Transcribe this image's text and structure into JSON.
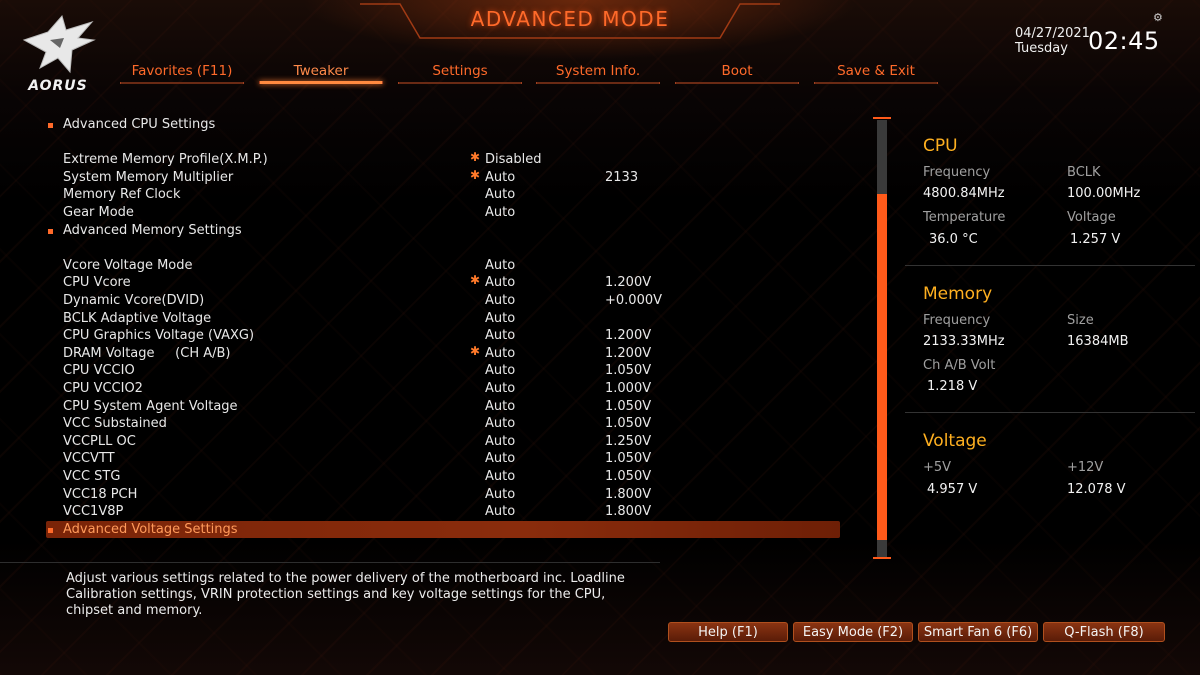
{
  "brand": "AORUS",
  "header": {
    "title": "ADVANCED MODE",
    "date": "04/27/2021",
    "day": "Tuesday",
    "time": "02:45"
  },
  "tabs": [
    {
      "label": "Favorites (F11)",
      "active": false
    },
    {
      "label": "Tweaker",
      "active": true
    },
    {
      "label": "Settings",
      "active": false
    },
    {
      "label": "System Info.",
      "active": false
    },
    {
      "label": "Boot",
      "active": false
    },
    {
      "label": "Save & Exit",
      "active": false
    }
  ],
  "settings": [
    {
      "label": "Advanced CPU Settings",
      "submenu": true,
      "value": "",
      "current": "",
      "star": false
    },
    {
      "label": "",
      "spacer": true
    },
    {
      "label": "Extreme Memory Profile(X.M.P.)",
      "value": "Disabled",
      "current": "",
      "star": true
    },
    {
      "label": "System Memory Multiplier",
      "value": "Auto",
      "current": "2133",
      "star": true
    },
    {
      "label": "Memory Ref Clock",
      "value": "Auto",
      "current": "",
      "star": false
    },
    {
      "label": "Gear Mode",
      "value": "Auto",
      "current": "",
      "star": false
    },
    {
      "label": "Advanced Memory Settings",
      "submenu": true,
      "value": "",
      "current": "",
      "star": false
    },
    {
      "label": "",
      "spacer": true
    },
    {
      "label": "Vcore Voltage Mode",
      "value": "Auto",
      "current": "",
      "star": false
    },
    {
      "label": "CPU Vcore",
      "value": "Auto",
      "current": "1.200V",
      "star": true
    },
    {
      "label": "Dynamic Vcore(DVID)",
      "value": "Auto",
      "current": "+0.000V",
      "star": false
    },
    {
      "label": "BCLK Adaptive Voltage",
      "value": "Auto",
      "current": "",
      "star": false
    },
    {
      "label": "CPU Graphics Voltage (VAXG)",
      "value": "Auto",
      "current": "1.200V",
      "star": false
    },
    {
      "label": "DRAM Voltage     (CH A/B)",
      "value": "Auto",
      "current": "1.200V",
      "star": true
    },
    {
      "label": "CPU VCCIO",
      "value": "Auto",
      "current": "1.050V",
      "star": false
    },
    {
      "label": "CPU VCCIO2",
      "value": "Auto",
      "current": "1.000V",
      "star": false
    },
    {
      "label": "CPU System Agent Voltage",
      "value": "Auto",
      "current": "1.050V",
      "star": false
    },
    {
      "label": "VCC Substained",
      "value": "Auto",
      "current": "1.050V",
      "star": false
    },
    {
      "label": "VCCPLL OC",
      "value": "Auto",
      "current": "1.250V",
      "star": false
    },
    {
      "label": "VCCVTT",
      "value": "Auto",
      "current": "1.050V",
      "star": false
    },
    {
      "label": "VCC STG",
      "value": "Auto",
      "current": "1.050V",
      "star": false
    },
    {
      "label": "VCC18 PCH",
      "value": "Auto",
      "current": "1.800V",
      "star": false
    },
    {
      "label": "VCC1V8P",
      "value": "Auto",
      "current": "1.800V",
      "star": false
    },
    {
      "label": "Advanced Voltage Settings",
      "submenu": true,
      "selected": true,
      "value": "",
      "current": "",
      "star": false
    }
  ],
  "scrollbar": {
    "visible_fraction": 0.79
  },
  "panel": {
    "cpu": {
      "title": "CPU",
      "frequency_label": "Frequency",
      "frequency": "4800.84MHz",
      "bclk_label": "BCLK",
      "bclk": "100.00MHz",
      "temperature_label": "Temperature",
      "temperature": "36.0 °C",
      "voltage_label": "Voltage",
      "voltage": "1.257 V"
    },
    "memory": {
      "title": "Memory",
      "frequency_label": "Frequency",
      "frequency": "2133.33MHz",
      "size_label": "Size",
      "size": "16384MB",
      "volt_label": "Ch A/B Volt",
      "volt": "1.218 V"
    },
    "voltage": {
      "title": "Voltage",
      "p5v_label": "+5V",
      "p5v": "4.957 V",
      "p12v_label": "+12V",
      "p12v": "12.078 V"
    }
  },
  "help": {
    "text": "Adjust various settings related to the power delivery of the motherboard inc. Loadline Calibration settings, VRIN protection settings and key voltage settings for the CPU, chipset and memory."
  },
  "bottom_buttons": [
    {
      "label": "Help (F1)"
    },
    {
      "label": "Easy Mode (F2)"
    },
    {
      "label": "Smart Fan 6 (F6)"
    },
    {
      "label": "Q-Flash (F8)"
    }
  ],
  "colors": {
    "accent": "#ff6a2a",
    "panel_heading": "#ffb020",
    "selected_row": "#7a2408"
  }
}
